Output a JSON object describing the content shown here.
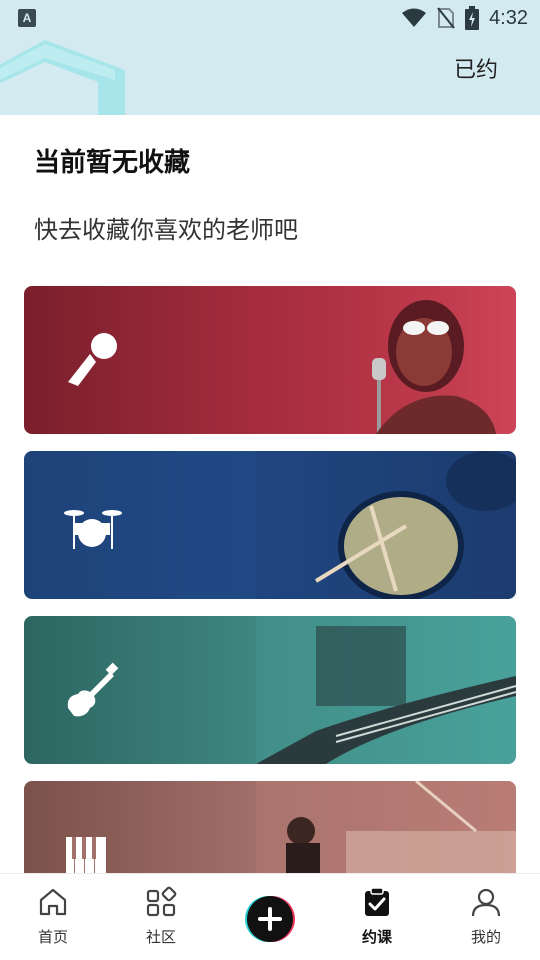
{
  "status_bar": {
    "time": "4:32",
    "left_icon_letter": "A"
  },
  "header": {
    "action_label": "已约"
  },
  "empty_state": {
    "title": "当前暂无收藏",
    "subtitle": "快去收藏你喜欢的老师吧"
  },
  "categories": [
    {
      "id": "vocal",
      "icon": "microphone-icon",
      "color": "#a32c3c"
    },
    {
      "id": "drum",
      "icon": "drum-kit-icon",
      "color": "#214a86"
    },
    {
      "id": "guitar",
      "icon": "electric-guitar-icon",
      "color": "#3f8882"
    },
    {
      "id": "piano",
      "icon": "piano-keys-icon",
      "color": "#a3706a"
    }
  ],
  "bottom_nav": {
    "items": [
      {
        "label": "首页",
        "icon": "home-icon"
      },
      {
        "label": "社区",
        "icon": "grid-icon"
      },
      {
        "label": "",
        "icon": "plus-icon"
      },
      {
        "label": "约课",
        "icon": "clipboard-check-icon",
        "active": true
      },
      {
        "label": "我的",
        "icon": "user-icon"
      }
    ]
  },
  "colors": {
    "header_bg": "#d3eaf0",
    "accent_cyan": "#28d0d6",
    "accent_pink": "#f0355c"
  }
}
